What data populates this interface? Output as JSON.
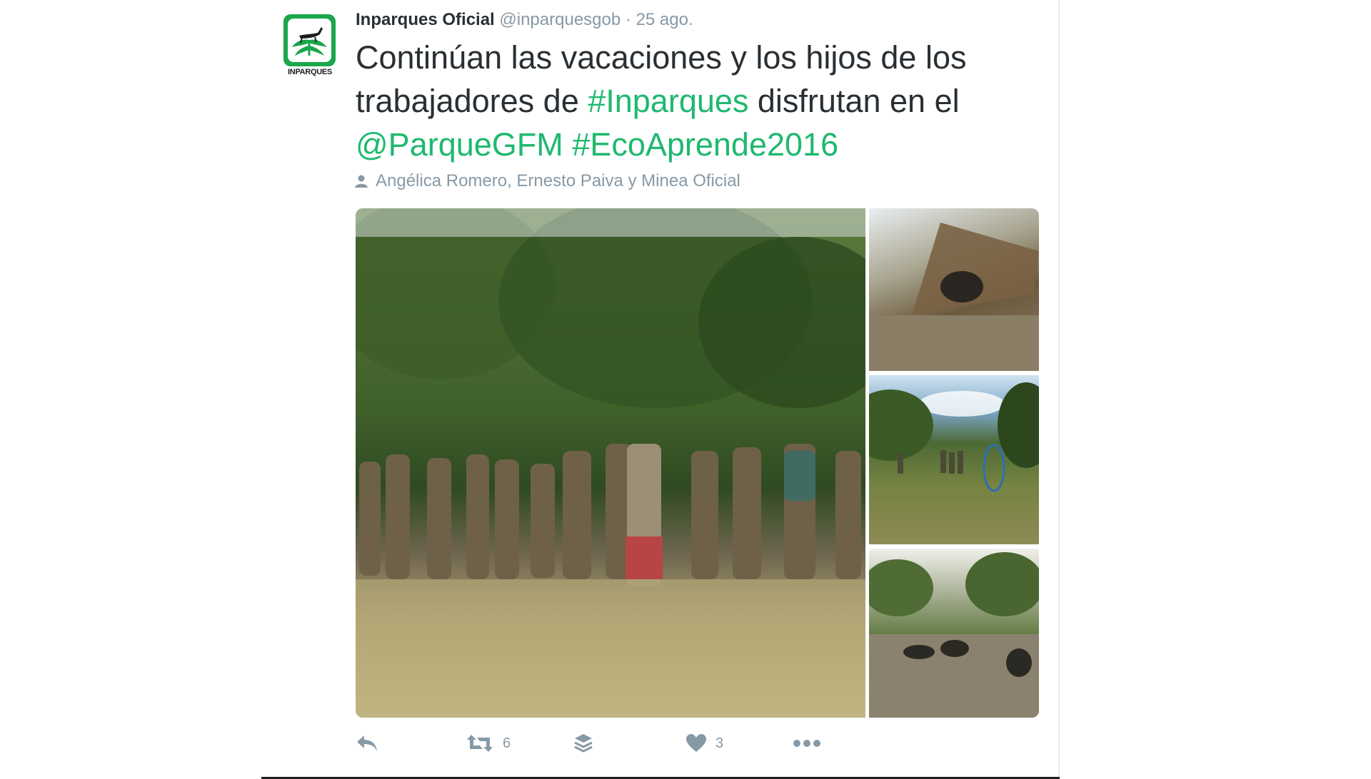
{
  "tweet": {
    "author_name": "Inparques Oficial",
    "handle": "@inparquesgob",
    "separator": "·",
    "time": "25 ago.",
    "avatar_caption": "INPARQUES",
    "text_line1": "Continúan las vacaciones y los hijos de los",
    "text_line2_a": "trabajadores de ",
    "hashtag1": "#Inparques",
    "text_line2_b": " disfrutan en el",
    "mention": "@ParqueGFM",
    "hashtag2": "#EcoAprende2016",
    "tagged_people": "Angélica Romero, Ernesto Paiva y Minea Oficial"
  },
  "actions": {
    "reply_icon": "reply-icon",
    "retweet_icon": "retweet-icon",
    "retweet_count": "6",
    "buffer_icon": "layers-icon",
    "like_icon": "heart-icon",
    "like_count": "3",
    "more_icon": "more-dots-icon"
  },
  "colors": {
    "link": "#1eb96f",
    "text": "#292f33",
    "muted": "#8899a6",
    "brand_green": "#1aa64a"
  }
}
